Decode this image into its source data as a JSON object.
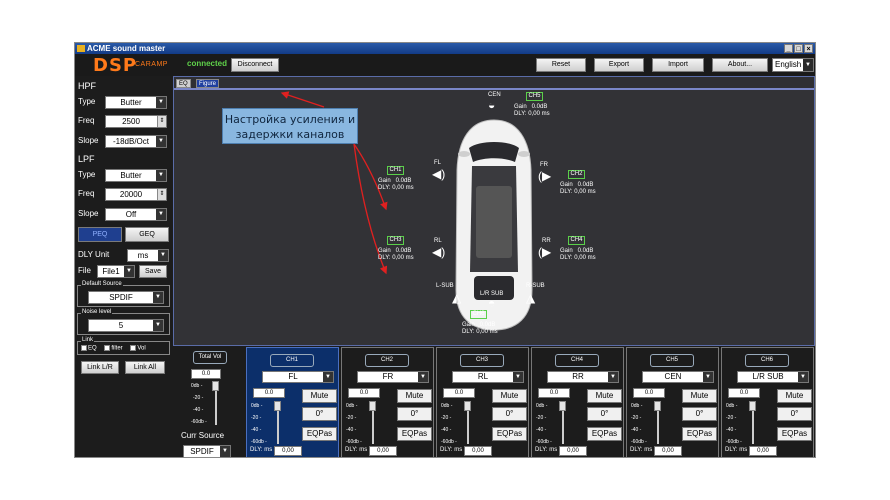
{
  "window": {
    "title": "ACME sound master"
  },
  "header": {
    "logo": "DSP",
    "brand": "CARAMP",
    "status": "connected",
    "disconnect": "Disconnect",
    "reset": "Reset",
    "export": "Export",
    "import": "Import",
    "about": "About...",
    "language": "English"
  },
  "left": {
    "hpf_title": "HPF",
    "type_label": "Type",
    "freq_label": "Freq",
    "slope_label": "Slope",
    "hpf_type": "Butter",
    "hpf_freq": "2500",
    "hpf_slope": "-18dB/Oct",
    "lpf_title": "LPF",
    "lpf_type": "Butter",
    "lpf_freq": "20000",
    "lpf_slope": "Off",
    "peq": "PEQ",
    "geq": "GEQ",
    "dly_unit_label": "DLY Unit",
    "dly_unit": "ms",
    "file_label": "File",
    "file": "File1",
    "save": "Save",
    "default_source_label": "Default Source",
    "default_source": "SPDIF",
    "noise_label": "Noise level",
    "noise": "5",
    "link_label": "Link",
    "link_eq": "EQ",
    "link_filter": "filter",
    "link_vol": "Vol",
    "link_lr": "Link L/R",
    "link_all": "Link All"
  },
  "tabs": [
    "EQ",
    "Figure"
  ],
  "annotation": "Настройка усиления и задержки каналов",
  "stage": {
    "cen_label": "CEN",
    "fl_label": "FL",
    "fr_label": "FR",
    "rl_label": "RL",
    "rr_label": "RR",
    "lsub_label": "L-SUB",
    "rsub_label": "R-SUB",
    "lrsub_label": "L/R SUB",
    "channels": [
      {
        "name": "CH1",
        "info": "Gain   0.0dB\nDLY: 0,00 ms"
      },
      {
        "name": "CH2",
        "info": "Gain   0.0dB\nDLY: 0,00 ms"
      },
      {
        "name": "CH3",
        "info": "Gain   0.0dB\nDLY: 0,00 ms"
      },
      {
        "name": "CH4",
        "info": "Gain   0.0dB\nDLY: 0,00 ms"
      },
      {
        "name": "CH5",
        "info": "Gain   0.0dB\nDLY: 0,00 ms"
      },
      {
        "name": "CH6",
        "info": "Gain   0.0dB\nDLY: 0,00 ms"
      }
    ]
  },
  "bottom": {
    "total_vol": "Total Vol",
    "total_value": "0.0",
    "curr_source_label": "Curr Source",
    "curr_source": "SPDIF",
    "scale": [
      "0db -",
      "-20 -",
      "-40 -",
      "-60db -"
    ],
    "mute": "Mute",
    "phase": "0°",
    "eqpas": "EQPas",
    "dly_label": "DLY: ms",
    "strips": [
      {
        "name": "CH1",
        "output": "FL",
        "gain": "0.0",
        "dly": "0,00"
      },
      {
        "name": "CH2",
        "output": "FR",
        "gain": "0.0",
        "dly": "0,00"
      },
      {
        "name": "CH3",
        "output": "RL",
        "gain": "0.0",
        "dly": "0,00"
      },
      {
        "name": "CH4",
        "output": "RR",
        "gain": "0.0",
        "dly": "0,00"
      },
      {
        "name": "CH5",
        "output": "CEN",
        "gain": "0.0",
        "dly": "0,00"
      },
      {
        "name": "CH6",
        "output": "L/R SUB",
        "gain": "0.0",
        "dly": "0,00"
      }
    ]
  },
  "colors": {
    "accent": "#ff7a1a",
    "connected": "#5fd24a",
    "selected_strip": "#0c2f6a",
    "arrow": "#e02020"
  }
}
